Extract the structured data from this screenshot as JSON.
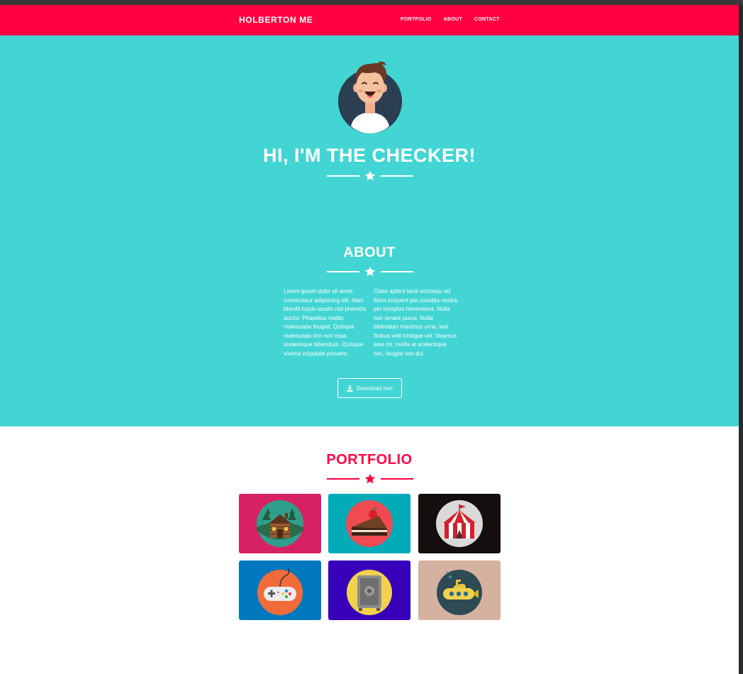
{
  "navbar": {
    "brand": "HOLBERTON ME",
    "links": [
      "PORTFOLIO",
      "ABOUT",
      "CONTACT"
    ]
  },
  "hero": {
    "title": "HI, I'M THE CHECKER!"
  },
  "about": {
    "title": "ABOUT",
    "col1": "Lorem ipsum dolor sit amet, consectetur adipiscing elit. Nam blandit turpis iaculis nisl pharetra auctor. Phasellus mattis malesuada feugiat. Quisque malesuada orci non risus scelerisque bibendum. Quisque viverra vulputate posuere.",
    "col2": "Class aptent taciti sociosqu ad litora torquent per conubia nostra, per inceptos himenaeos. Nulla non ornare purus. Nulla bibendum maximus urna, sed finibus velit tristique vel. Vivamus ante mi, mollis at scelerisque nec, feugiat non dui.",
    "download_label": "Download me!"
  },
  "portfolio": {
    "title": "PORTFOLIO",
    "items": [
      {
        "icon": "cabin-icon",
        "bg": "#d62163"
      },
      {
        "icon": "cake-icon",
        "bg": "#00aab7"
      },
      {
        "icon": "circus-tent-icon",
        "bg": "#140e0f"
      },
      {
        "icon": "game-controller-icon",
        "bg": "#0078c0"
      },
      {
        "icon": "safe-icon",
        "bg": "#3700b8"
      },
      {
        "icon": "submarine-icon",
        "bg": "#d5b1a0"
      }
    ]
  },
  "colors": {
    "accent": "#ff0040",
    "hero_bg": "#42d5d3",
    "white": "#ffffff"
  }
}
